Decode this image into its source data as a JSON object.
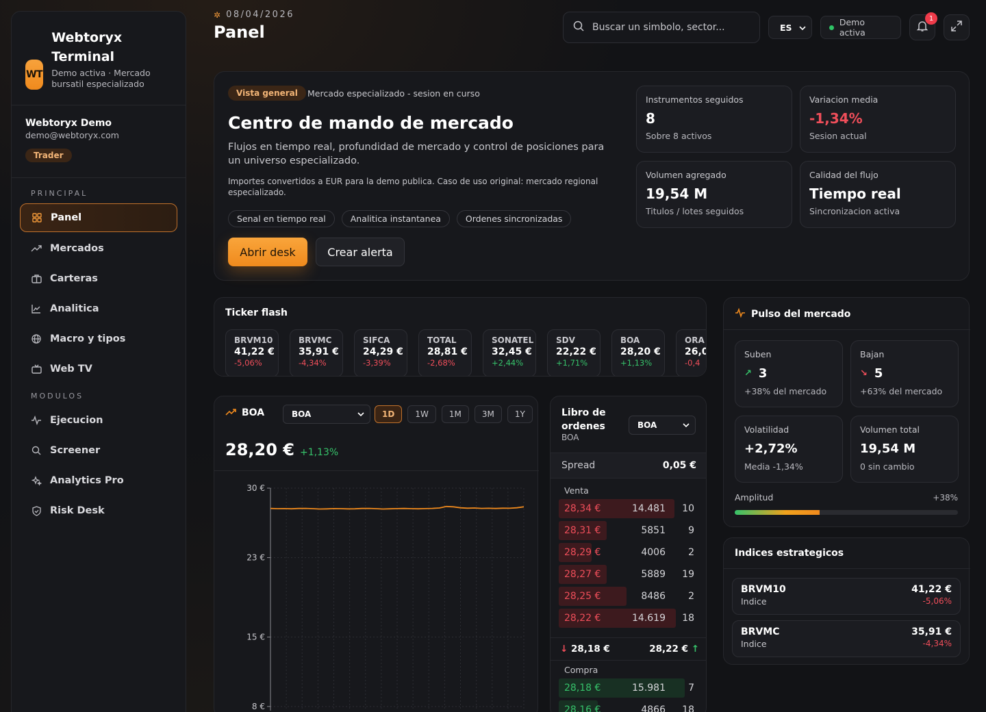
{
  "brand": {
    "logo": "WT",
    "name": "Webtoryx Terminal",
    "subtitle": "Demo activa · Mercado bursatil especializado"
  },
  "user": {
    "name": "Webtoryx Demo",
    "email": "demo@webtoryx.com",
    "role": "Trader"
  },
  "nav": {
    "principal_label": "PRINCIPAL",
    "principal": [
      {
        "label": "Panel",
        "icon": "grid-icon",
        "active": true
      },
      {
        "label": "Mercados",
        "icon": "trend-icon"
      },
      {
        "label": "Carteras",
        "icon": "briefcase-icon"
      },
      {
        "label": "Analitica",
        "icon": "chart-icon"
      },
      {
        "label": "Macro y tipos",
        "icon": "globe-icon"
      },
      {
        "label": "Web TV",
        "icon": "tv-icon"
      }
    ],
    "modulos_label": "MODULOS",
    "modulos": [
      {
        "label": "Ejecucion",
        "icon": "activity-icon"
      },
      {
        "label": "Screener",
        "icon": "search-icon"
      },
      {
        "label": "Analytics Pro",
        "icon": "sparkle-icon"
      },
      {
        "label": "Risk Desk",
        "icon": "shield-icon"
      }
    ]
  },
  "header": {
    "date": "08/04/2026",
    "title": "Panel",
    "search_placeholder": "Buscar un simbolo, sector...",
    "lang": "ES",
    "demo_label": "Demo activa",
    "notifications": "1"
  },
  "hero": {
    "tag": "Vista general",
    "tagline": "Mercado especializado - sesion en curso",
    "title": "Centro de mando de mercado",
    "description": "Flujos en tiempo real, profundidad de mercado y control de posiciones para un universo especializado.",
    "note": "Importes convertidos a EUR para la demo publica. Caso de uso original: mercado regional especializado.",
    "chips": [
      "Senal en tiempo real",
      "Analitica instantanea",
      "Ordenes sincronizadas"
    ],
    "primary_button": "Abrir desk",
    "secondary_button": "Crear alerta",
    "stats": [
      {
        "label": "Instrumentos seguidos",
        "value": "8",
        "sub": "Sobre 8 activos"
      },
      {
        "label": "Variacion media",
        "value": "-1,34%",
        "sub": "Sesion actual",
        "negative": true
      },
      {
        "label": "Volumen agregado",
        "value": "19,54 M",
        "sub": "Titulos / lotes seguidos"
      },
      {
        "label": "Calidad del flujo",
        "value": "Tiempo real",
        "sub": "Sincronizacion activa"
      }
    ]
  },
  "ticker": {
    "title": "Ticker flash",
    "items": [
      {
        "symbol": "BRVM10",
        "price": "41,22 €",
        "change": "-5,06%",
        "dir": "neg"
      },
      {
        "symbol": "BRVMC",
        "price": "35,91 €",
        "change": "-4,34%",
        "dir": "neg"
      },
      {
        "symbol": "SIFCA",
        "price": "24,29 €",
        "change": "-3,39%",
        "dir": "neg"
      },
      {
        "symbol": "TOTAL",
        "price": "28,81 €",
        "change": "-2,68%",
        "dir": "neg"
      },
      {
        "symbol": "SONATEL",
        "price": "32,45 €",
        "change": "+2,44%",
        "dir": "pos"
      },
      {
        "symbol": "SDV",
        "price": "22,22 €",
        "change": "+1,71%",
        "dir": "pos"
      },
      {
        "symbol": "BOA",
        "price": "28,20 €",
        "change": "+1,13%",
        "dir": "pos"
      },
      {
        "symbol": "ORA",
        "price": "26,0",
        "change": "-0,4",
        "dir": "neg"
      }
    ]
  },
  "chart": {
    "symbol": "BOA",
    "select_value": "BOA",
    "ranges": [
      "1D",
      "1W",
      "1M",
      "3M",
      "1Y"
    ],
    "active_range": "1D",
    "price": "28,20 €",
    "change": "+1,13%"
  },
  "chart_data": {
    "type": "line",
    "title": "",
    "xlabel": "",
    "ylabel": "",
    "ylim": [
      8,
      30
    ],
    "yticks": [
      "30 €",
      "23 €",
      "15 €",
      "8 €"
    ],
    "ytick_values": [
      30,
      23,
      15,
      8
    ],
    "series": [
      {
        "color": "#f08a1d",
        "values": [
          27.95,
          27.93,
          27.94,
          27.92,
          27.95,
          27.96,
          27.93,
          27.9,
          27.91,
          27.94,
          27.93,
          27.91,
          27.92,
          27.95,
          27.96,
          27.93,
          27.9,
          27.92,
          27.94,
          27.95,
          27.93,
          27.92,
          27.94,
          27.96,
          28.0,
          28.15,
          28.12,
          28.02,
          27.98,
          28.0,
          27.96,
          27.97,
          27.95,
          27.98,
          27.97,
          28.02,
          28.12
        ]
      }
    ],
    "grid": true
  },
  "orderbook": {
    "title": "Libro de ordenes",
    "symbol": "BOA",
    "select_value": "BOA",
    "spread_label": "Spread",
    "spread_value": "0,05 €",
    "sell_label": "Venta",
    "buy_label": "Compra",
    "asks": [
      {
        "price": "28,34 €",
        "qty": "14.481",
        "orders": "10",
        "depth": 0.92
      },
      {
        "price": "28,31 €",
        "qty": "5851",
        "orders": "9",
        "depth": 0.38
      },
      {
        "price": "28,29 €",
        "qty": "4006",
        "orders": "2",
        "depth": 0.26
      },
      {
        "price": "28,27 €",
        "qty": "5889",
        "orders": "19",
        "depth": 0.38
      },
      {
        "price": "28,25 €",
        "qty": "8486",
        "orders": "2",
        "depth": 0.54
      },
      {
        "price": "28,22 €",
        "qty": "14.619",
        "orders": "18",
        "depth": 0.93
      }
    ],
    "mid_bid": "28,18 €",
    "mid_ask": "28,22 €",
    "bids": [
      {
        "price": "28,18 €",
        "qty": "15.981",
        "orders": "7",
        "depth": 1.0
      },
      {
        "price": "28,16 €",
        "qty": "4866",
        "orders": "18",
        "depth": 0.31
      }
    ]
  },
  "pulse": {
    "title": "Pulso del mercado",
    "boxes": [
      {
        "label": "Suben",
        "value": "3",
        "sub": "+38% del mercado",
        "icon": "arrow-up-right-icon"
      },
      {
        "label": "Bajan",
        "value": "5",
        "sub": "+63% del mercado",
        "icon": "arrow-down-right-icon"
      },
      {
        "label": "Volatilidad",
        "value": "+2,72%",
        "sub": "Media -1,34%"
      },
      {
        "label": "Volumen total",
        "value": "19,54 M",
        "sub": "0 sin cambio"
      }
    ],
    "amplitude_label": "Amplitud",
    "amplitude_value": "+38%",
    "amplitude_fraction": 0.38
  },
  "indices": {
    "title": "Indices estrategicos",
    "items": [
      {
        "symbol": "BRVM10",
        "type": "Indice",
        "price": "41,22 €",
        "change": "-5,06%"
      },
      {
        "symbol": "BRVMC",
        "type": "Indice",
        "price": "35,91 €",
        "change": "-4,34%"
      }
    ]
  }
}
